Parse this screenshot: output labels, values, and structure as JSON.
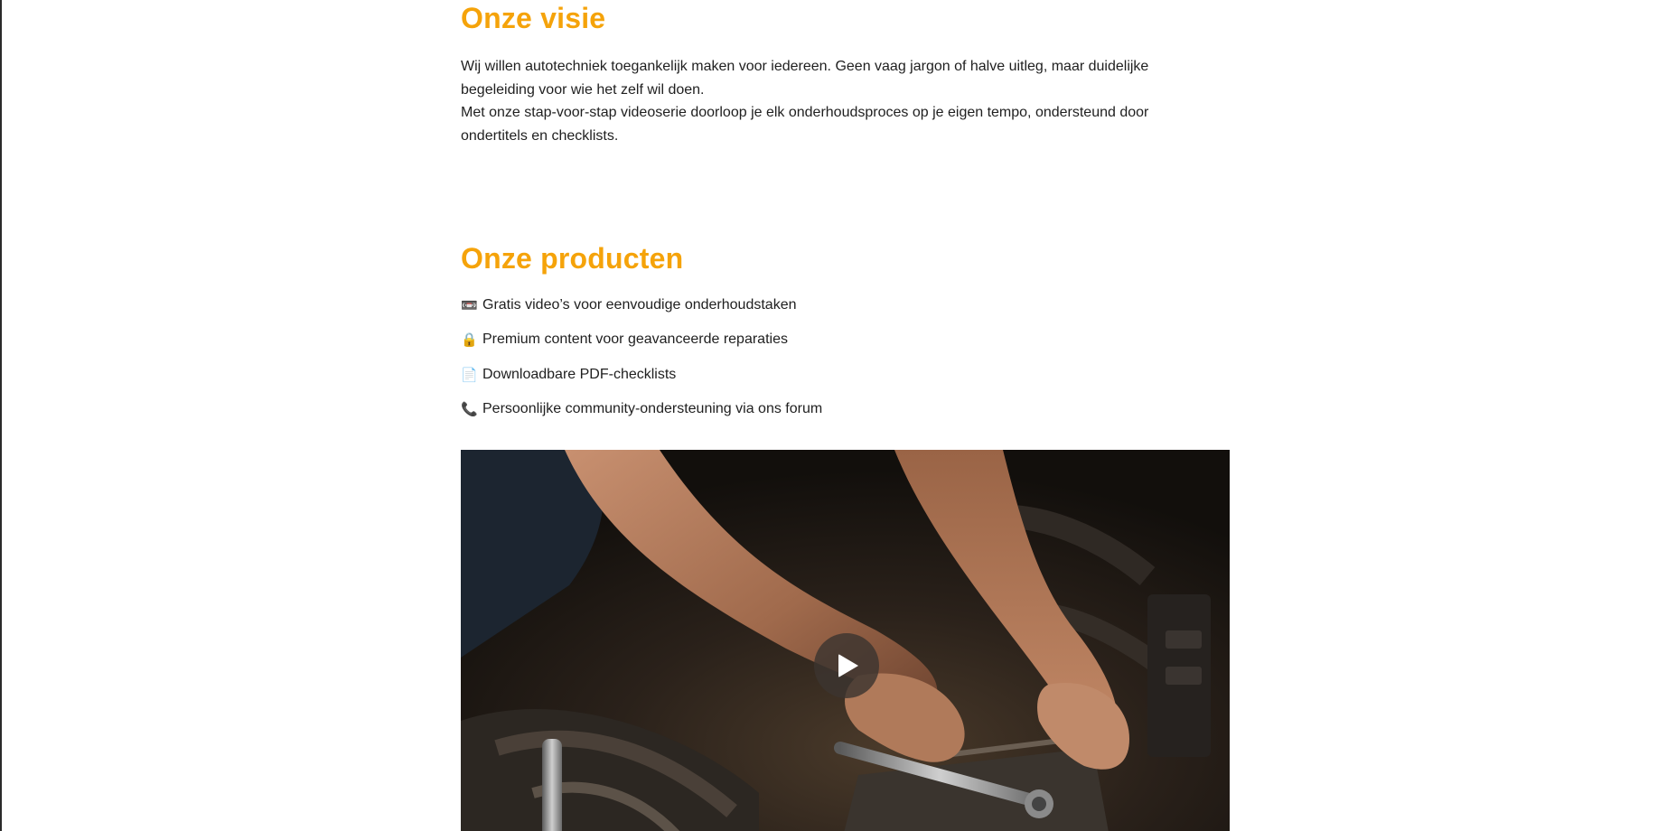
{
  "vision": {
    "title": "Onze visie",
    "paragraph1": "Wij willen autotechniek toegankelijk maken voor iedereen. Geen vaag jargon of halve uitleg, maar duidelijke begeleiding voor wie het zelf wil doen.",
    "paragraph2": "Met onze stap-voor-stap videoserie doorloop je elk onderhoudsproces op je eigen tempo, ondersteund door ondertitels en checklists."
  },
  "products": {
    "title": "Onze producten",
    "items": [
      {
        "icon": "📼",
        "icon_name": "video-tape-icon",
        "label": "Gratis video’s voor eenvoudige onderhoudstaken"
      },
      {
        "icon": "🔒",
        "icon_name": "lock-icon",
        "label": "Premium content voor geavanceerde reparaties"
      },
      {
        "icon": "📄",
        "icon_name": "document-icon",
        "label": "Downloadbare PDF-checklists"
      },
      {
        "icon": "📞",
        "icon_name": "phone-icon",
        "label": "Persoonlijke community-ondersteuning via ons forum"
      }
    ]
  },
  "video": {
    "icon_name": "play-icon"
  },
  "colors": {
    "heading": "#f5a30a",
    "text": "#1f1f1f",
    "background": "#ffffff"
  }
}
